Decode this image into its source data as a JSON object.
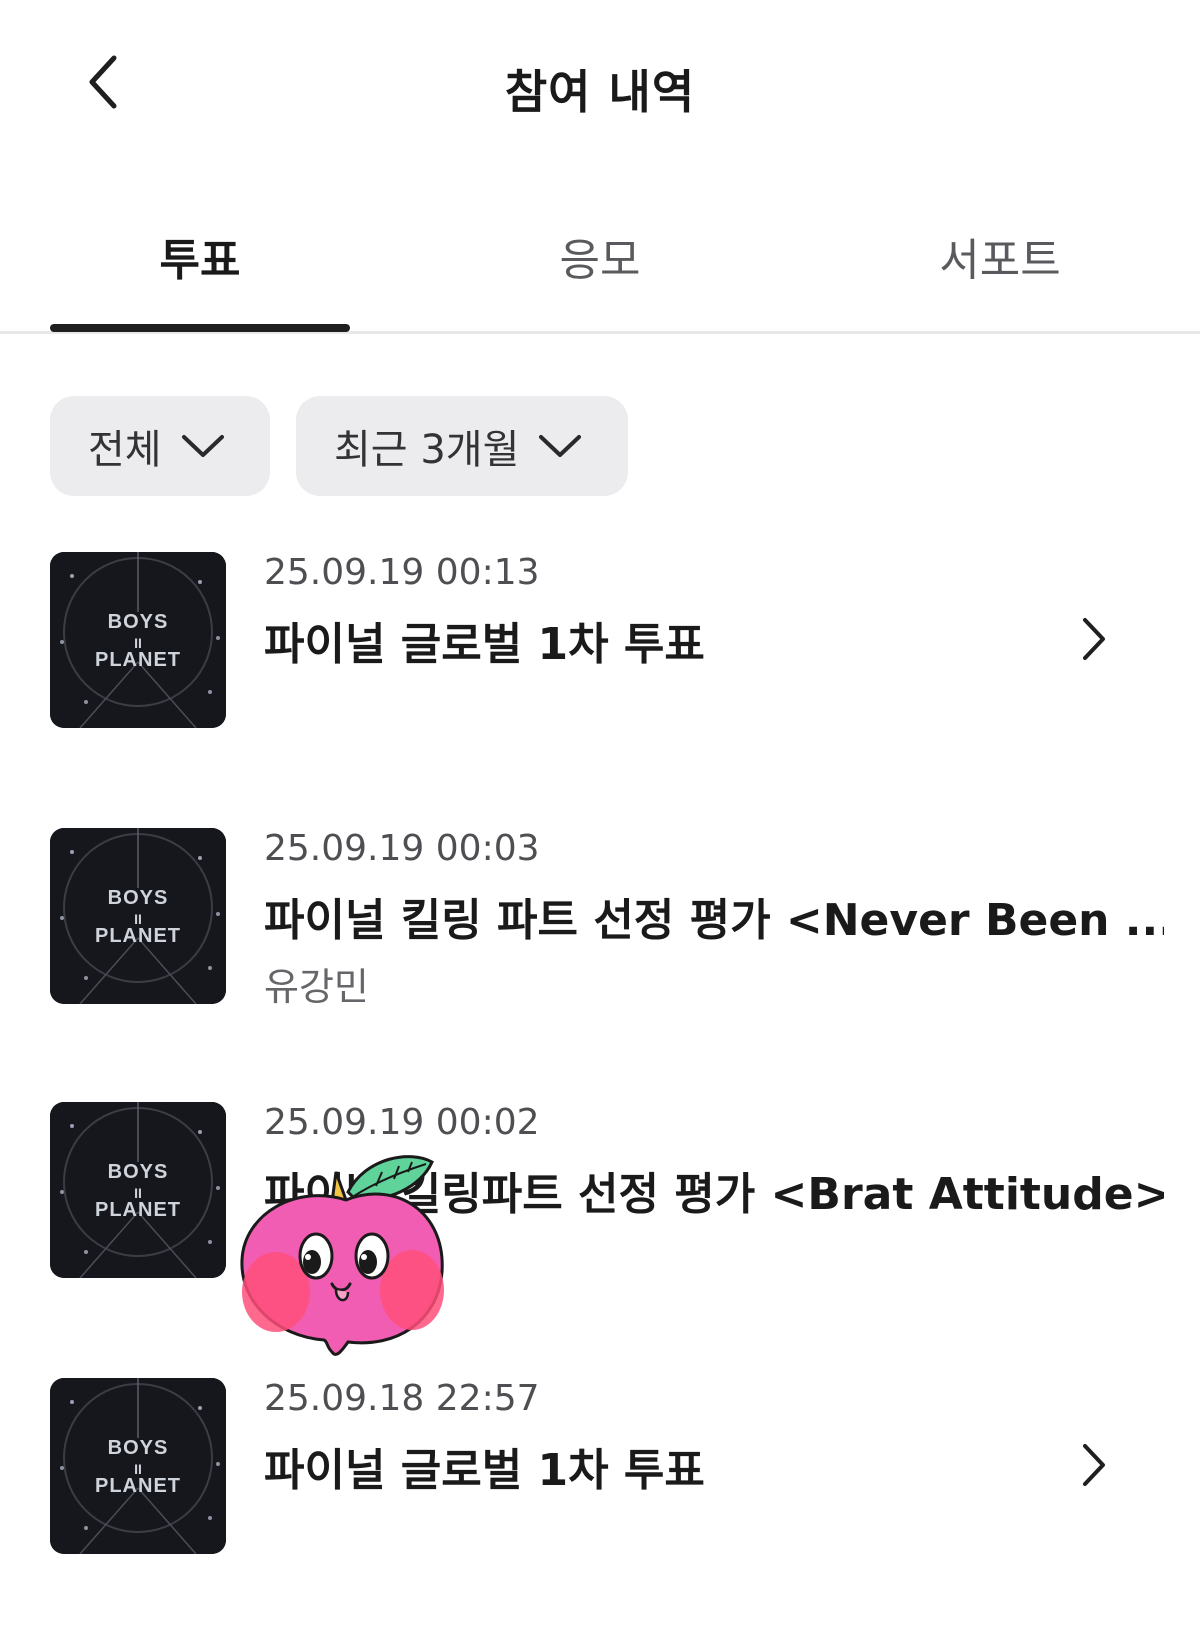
{
  "header": {
    "title": "참여 내역",
    "back_icon": "chevron-left-icon"
  },
  "tabs": [
    {
      "label": "투표",
      "active": true
    },
    {
      "label": "응모",
      "active": false
    },
    {
      "label": "서포트",
      "active": false
    }
  ],
  "filters": [
    {
      "label": "전체",
      "icon": "chevron-down-icon"
    },
    {
      "label": "최근 3개월",
      "icon": "chevron-down-icon"
    }
  ],
  "items": [
    {
      "date": "25.09.19 00:13",
      "title": "파이널 글로벌 1차 투표",
      "subtitle": "",
      "has_arrow": true,
      "thumb": {
        "line1": "BOYS",
        "line2": "II",
        "line3": "PLANET"
      }
    },
    {
      "date": "25.09.19 00:03",
      "title": "파이널 킬링 파트 선정 평가 <Never Been ...",
      "subtitle": "유강민",
      "has_arrow": false,
      "thumb": {
        "line1": "BOYS",
        "line2": "II",
        "line3": "PLANET"
      }
    },
    {
      "date": "25.09.19 00:02",
      "title": "파이널 킬링파트 선정 평가 <Brat Attitude>",
      "subtitle": "",
      "has_arrow": false,
      "thumb": {
        "line1": "BOYS",
        "line2": "II",
        "line3": "PLANET"
      }
    },
    {
      "date": "25.09.18 22:57",
      "title": "파이널 글로벌 1차 투표",
      "subtitle": "",
      "has_arrow": true,
      "thumb": {
        "line1": "BOYS",
        "line2": "II",
        "line3": "PLANET"
      }
    }
  ],
  "colors": {
    "accent": "#1f1f1f",
    "filter_bg": "#ececef",
    "divider": "#e8e8ea",
    "sticker_pink": "#f25db4"
  }
}
